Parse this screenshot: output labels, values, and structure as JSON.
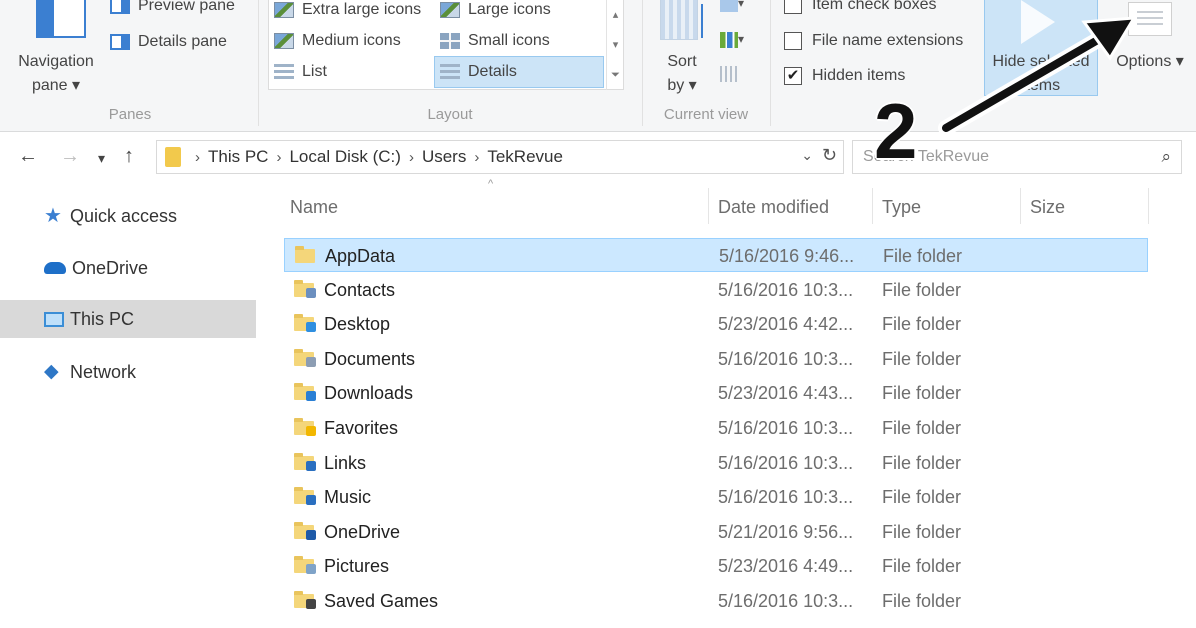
{
  "ribbon": {
    "panes": {
      "nav_pane_label": "Navigation pane ▾",
      "preview_pane": "Preview pane",
      "details_pane": "Details pane",
      "group": "Panes"
    },
    "layout": {
      "extra_large_icons": "Extra large icons",
      "large_icons": "Large icons",
      "medium_icons": "Medium icons",
      "small_icons": "Small icons",
      "list": "List",
      "details": "Details",
      "group": "Layout"
    },
    "current_view": {
      "sort_by": "Sort by ▾",
      "group": "Current view"
    },
    "show_hide": {
      "item_check_boxes": "Item check boxes",
      "file_name_extensions": "File name extensions",
      "hidden_items": "Hidden items",
      "hidden_items_checked": "✔",
      "hide_selected": "Hide selected items",
      "options": "Options ▾"
    }
  },
  "address": {
    "back": "←",
    "forward": "→",
    "recent": "▾",
    "up": "↑",
    "crumbs": [
      "This PC",
      "Local Disk (C:)",
      "Users",
      "TekRevue"
    ],
    "sep": "›",
    "dropdown": "⌄",
    "refresh": "↻",
    "search_placeholder": "Search TekRevue",
    "search_icon": "⌕"
  },
  "nav": {
    "items": [
      {
        "label": "Quick access",
        "icon": "star-icon"
      },
      {
        "label": "OneDrive",
        "icon": "cloud-icon"
      },
      {
        "label": "This PC",
        "icon": "computer-icon"
      },
      {
        "label": "Network",
        "icon": "network-icon"
      }
    ]
  },
  "list": {
    "columns": [
      "Name",
      "Date modified",
      "Type",
      "Size"
    ],
    "sort_caret": "^",
    "rows": [
      {
        "name": "AppData",
        "date": "5/16/2016 9:46...",
        "type": "File folder",
        "badge": ""
      },
      {
        "name": "Contacts",
        "date": "5/16/2016 10:3...",
        "type": "File folder",
        "badge": "#6b8fbf"
      },
      {
        "name": "Desktop",
        "date": "5/23/2016 4:42...",
        "type": "File folder",
        "badge": "#2f8fe0"
      },
      {
        "name": "Documents",
        "date": "5/16/2016 10:3...",
        "type": "File folder",
        "badge": "#8c9db3"
      },
      {
        "name": "Downloads",
        "date": "5/23/2016 4:43...",
        "type": "File folder",
        "badge": "#2a7fd4"
      },
      {
        "name": "Favorites",
        "date": "5/16/2016 10:3...",
        "type": "File folder",
        "badge": "#f2b700"
      },
      {
        "name": "Links",
        "date": "5/16/2016 10:3...",
        "type": "File folder",
        "badge": "#2a6fc0"
      },
      {
        "name": "Music",
        "date": "5/16/2016 10:3...",
        "type": "File folder",
        "badge": "#2a6fc0"
      },
      {
        "name": "OneDrive",
        "date": "5/21/2016 9:56...",
        "type": "File folder",
        "badge": "#1e5aa8"
      },
      {
        "name": "Pictures",
        "date": "5/23/2016 4:49...",
        "type": "File folder",
        "badge": "#7fa3c8"
      },
      {
        "name": "Saved Games",
        "date": "5/16/2016 10:3...",
        "type": "File folder",
        "badge": "#444444"
      }
    ]
  },
  "annotation": {
    "number": "2"
  },
  "colors": {
    "accent": "#3b7fd1",
    "selection": "#cce8ff",
    "folder": "#f4d67a"
  }
}
